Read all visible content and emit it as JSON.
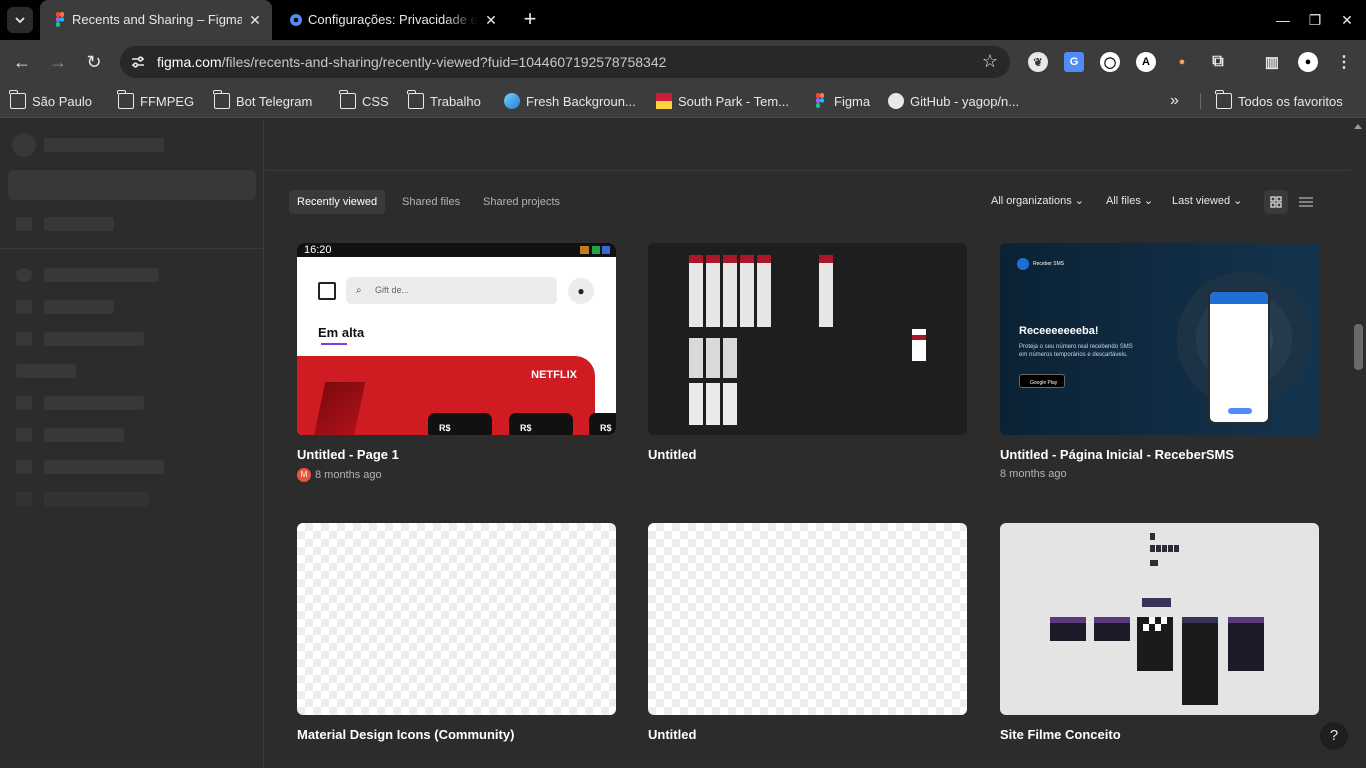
{
  "browser": {
    "tabs": [
      {
        "title": "Recents and Sharing – Figma",
        "active": true
      },
      {
        "title": "Configurações: Privacidade e segurança",
        "active": false
      }
    ],
    "url_host": "figma.com",
    "url_path": "/files/recents-and-sharing/recently-viewed?fuid=1044607192578758342",
    "bookmarks": [
      "São Paulo",
      "FFMPEG",
      "Bot Telegram",
      "CSS",
      "Trabalho",
      "Fresh Backgroun...",
      "South Park - Tem...",
      "Figma",
      "GitHub - yagop/n..."
    ],
    "all_bookmarks": "Todos os favoritos"
  },
  "main": {
    "tabs": [
      "Recently viewed",
      "Shared files",
      "Shared projects"
    ],
    "filters": {
      "org": "All organizations",
      "files": "All files",
      "sort": "Last viewed"
    },
    "files": [
      {
        "title": "Untitled - Page 1",
        "meta": "8 months ago",
        "avatar": "M"
      },
      {
        "title": "Untitled",
        "meta": ""
      },
      {
        "title": "Untitled - Página Inicial - ReceberSMS",
        "meta": "8 months ago"
      },
      {
        "title": "Material Design Icons (Community)",
        "meta": ""
      },
      {
        "title": "Untitled",
        "meta": ""
      },
      {
        "title": "Site Filme Conceito",
        "meta": ""
      }
    ],
    "thumb1": {
      "time": "16:20",
      "search": "Gift de...",
      "heading": "Em alta",
      "brand": "NETFLIX",
      "price": "R$"
    },
    "thumb3": {
      "logo": "Receber SMS",
      "headline": "Receeeeeeeba!",
      "body": "Proteja o seu número real recebendo SMS em números temporários e descartáveis.",
      "store": "Google Play"
    },
    "help": "?"
  },
  "colors": {
    "accent": "#a259ff",
    "netflix": "#e50914",
    "bg": "#2c2c2c"
  }
}
